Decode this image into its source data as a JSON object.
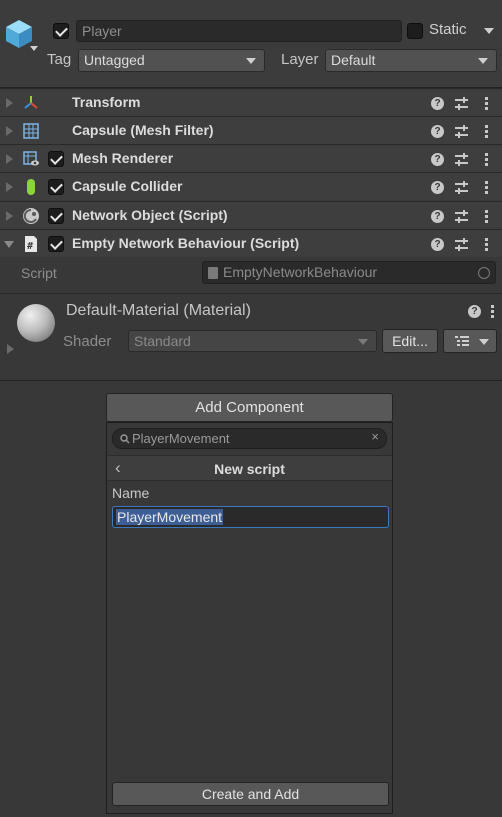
{
  "header": {
    "object_name": "Player",
    "static_label": "Static",
    "tag_label": "Tag",
    "tag_value": "Untagged",
    "layer_label": "Layer",
    "layer_value": "Default"
  },
  "components": [
    {
      "name": "Transform",
      "icon": "transform-icon",
      "checkbox": false,
      "expanded": false
    },
    {
      "name": "Capsule (Mesh Filter)",
      "icon": "mesh-filter-icon",
      "checkbox": false,
      "expanded": false
    },
    {
      "name": "Mesh Renderer",
      "icon": "mesh-renderer-icon",
      "checkbox": true,
      "expanded": false
    },
    {
      "name": "Capsule Collider",
      "icon": "capsule-collider-icon",
      "checkbox": true,
      "expanded": false
    },
    {
      "name": "Network Object (Script)",
      "icon": "network-object-icon",
      "checkbox": true,
      "expanded": false
    },
    {
      "name": "Empty Network Behaviour (Script)",
      "icon": "script-icon",
      "checkbox": true,
      "expanded": true
    }
  ],
  "script_row": {
    "label": "Script",
    "value": "EmptyNetworkBehaviour"
  },
  "material": {
    "title": "Default-Material (Material)",
    "shader_label": "Shader",
    "shader_value": "Standard",
    "edit_label": "Edit..."
  },
  "add_component": {
    "button_label": "Add Component",
    "search_value": "PlayerMovement",
    "nav_title": "New script",
    "name_label": "Name",
    "name_value": "PlayerMovement",
    "create_label": "Create and Add"
  },
  "colors": {
    "background": "#383838",
    "selection": "#3e5f96",
    "field_focus": "#3a79bb",
    "collider_green": "#8cd43c",
    "cube_blue": "#5fb8e8"
  }
}
